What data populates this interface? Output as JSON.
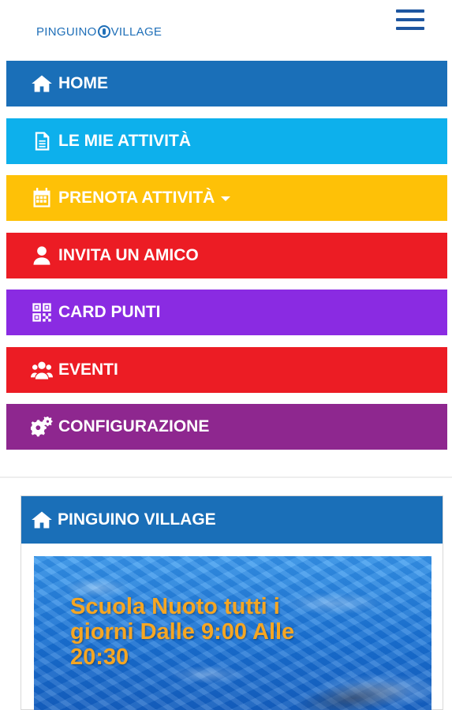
{
  "header": {
    "logo_text_left": "PINGUINO",
    "logo_text_right": "VILLAGE"
  },
  "menu": {
    "items": [
      {
        "label": "HOME",
        "icon": "home-icon",
        "color": "#1a6fb8"
      },
      {
        "label": "LE MIE ATTIVITÀ",
        "icon": "document-icon",
        "color": "#0db0ec"
      },
      {
        "label": "PRENOTA ATTIVITÀ",
        "icon": "calendar-icon",
        "color": "#fec107",
        "has_dropdown": true
      },
      {
        "label": "INVITA UN AMICO",
        "icon": "user-icon",
        "color": "#ec1c24"
      },
      {
        "label": "CARD PUNTI",
        "icon": "qrcode-icon",
        "color": "#8a2be2"
      },
      {
        "label": "EVENTI",
        "icon": "users-icon",
        "color": "#ec1c24"
      },
      {
        "label": "CONFIGURAZIONE",
        "icon": "gears-icon",
        "color": "#8e278f"
      }
    ]
  },
  "panel": {
    "title": "PINGUINO VILLAGE",
    "icon": "home-icon",
    "color": "#1a6fb8",
    "banner_text": "Scuola Nuoto tutti i giorni Dalle 9:00 Alle 20:30",
    "banner_text_color": "#f5a623"
  }
}
